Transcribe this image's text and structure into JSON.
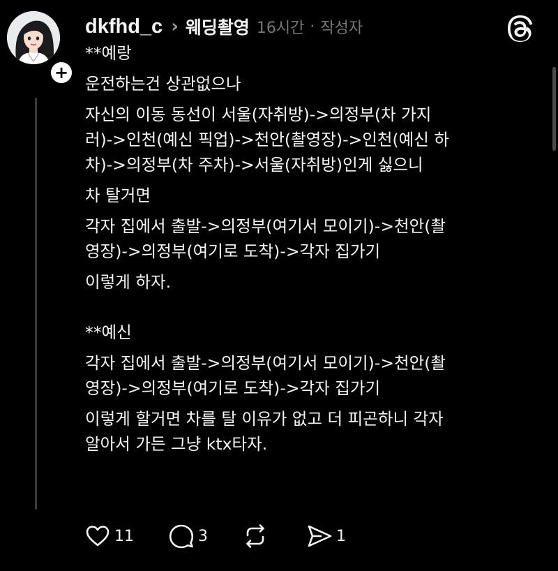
{
  "post": {
    "author": {
      "username": "dkfhd_c",
      "avatar_icon": "user-avatar-illustration",
      "follow_icon": "plus-icon"
    },
    "topic": "웨딩촬영",
    "time": "16시간",
    "author_badge": "작성자",
    "separator": "·",
    "app_icon": "threads-logo-icon",
    "body_lines": [
      "**예랑",
      "운전하는건 상관없으나",
      "자신의 이동 동선이 서울(자취방)->의정부(차 가지",
      "러)->인천(예신 픽업)->천안(촬영장)->인천(예신 하",
      "차)->의정부(차 주차)->서울(자취방)인게 싫으니",
      "차 탈거면",
      "각자 집에서 출발->의정부(여기서 모이기)->천안(촬",
      "영장)->의정부(여기로 도착)->각자 집가기",
      "이렇게 하자.",
      "",
      "**예신",
      "각자 집에서 출발->의정부(여기서 모이기)->천안(촬",
      "영장)->의정부(여기로 도착)->각자 집가기",
      "이렇게 할거면 차를 탈 이유가 없고 더 피곤하니 각자",
      "알아서 가든 그냥 ktx타자."
    ],
    "actions": {
      "like": {
        "icon": "heart-icon",
        "count": "11"
      },
      "reply": {
        "icon": "comment-icon",
        "count": "3"
      },
      "repost": {
        "icon": "repost-icon",
        "count": ""
      },
      "share": {
        "icon": "send-icon",
        "count": "1"
      }
    }
  },
  "colors": {
    "background": "#000000",
    "text": "#f3f5f7",
    "muted": "#777777",
    "thread_line": "#3a3a3a"
  }
}
